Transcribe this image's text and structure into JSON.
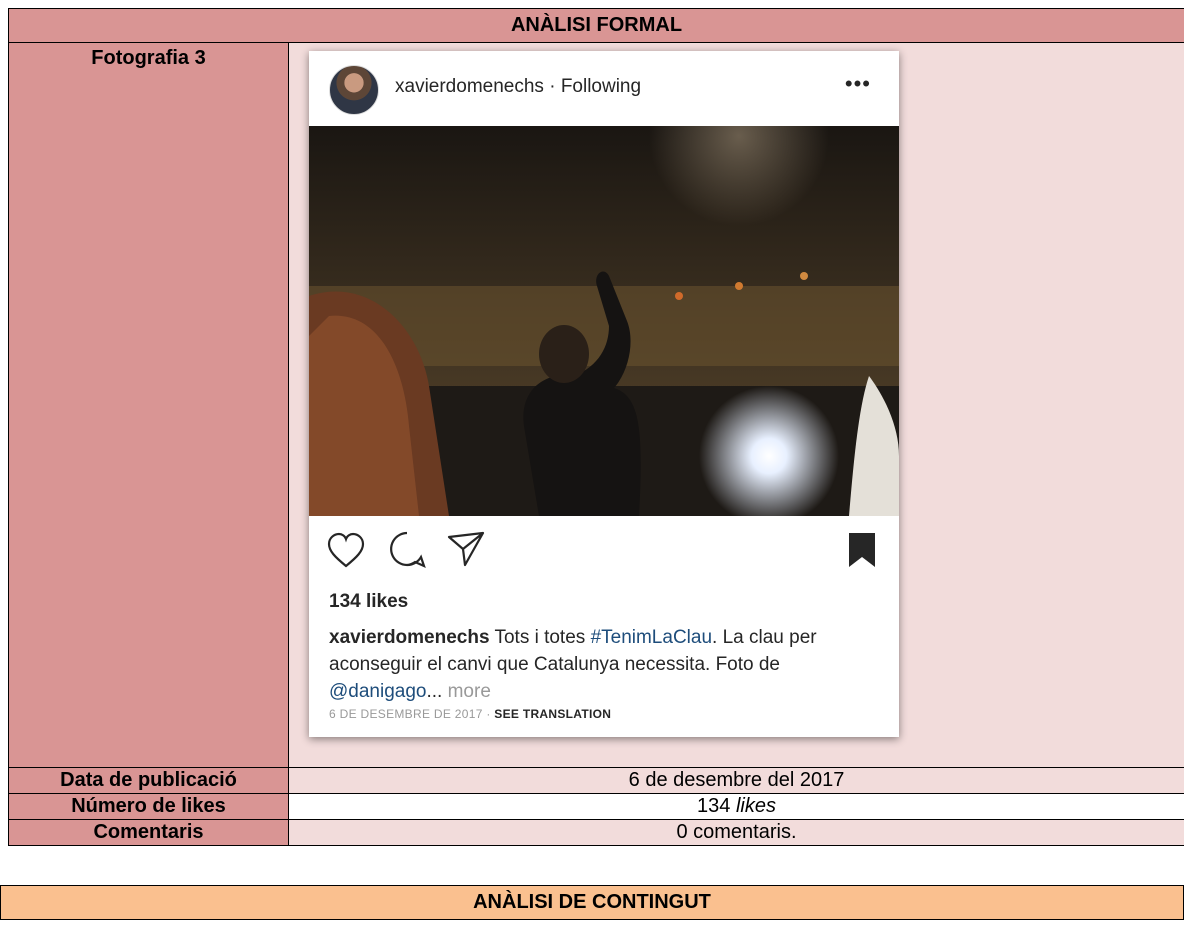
{
  "formal": {
    "header": "ANÀLISI FORMAL",
    "photo_label": "Fotografia 3",
    "rows": [
      {
        "label": "Data de publicació",
        "value": "6 de desembre del 2017"
      },
      {
        "label": "Número de likes",
        "value_num": "134 ",
        "value_em": "likes"
      },
      {
        "label": "Comentaris",
        "value": "0 comentaris."
      }
    ]
  },
  "content": {
    "header": "ANÀLISI DE CONTINGUT"
  },
  "post": {
    "username": "xavierdomenechs",
    "separator": " · ",
    "follow_status": "Following",
    "more_menu": "•••",
    "likes": "134 likes",
    "caption_user": "xavierdomenechs",
    "caption_text_1": " Tots i totes ",
    "caption_hashtag": "#TenimLaClau",
    "caption_text_2": ". La clau per aconseguir el canvi que Catalunya necessita. Foto de ",
    "caption_mention": "@danigago",
    "caption_ellipsis": "... ",
    "caption_more": "more",
    "date": "6 DE DESEMBRE DE 2017",
    "date_sep": " · ",
    "translate": "SEE TRANSLATION",
    "icons": [
      "heart-icon",
      "comment-icon",
      "share-icon",
      "bookmark-icon"
    ]
  }
}
